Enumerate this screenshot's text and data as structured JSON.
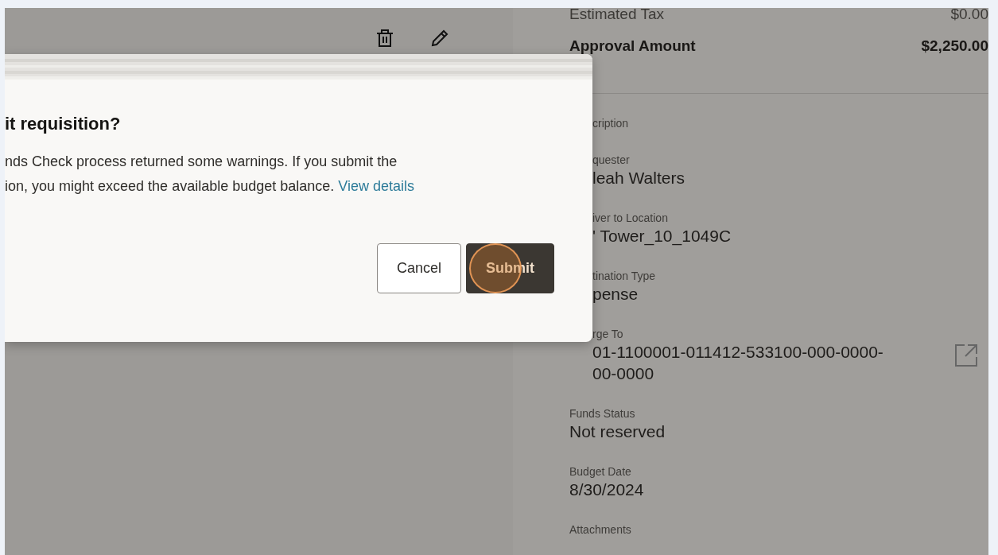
{
  "toolbar": {
    "icons": [
      {
        "kind": "delete"
      },
      {
        "kind": "edit"
      }
    ]
  },
  "dialog": {
    "title": "it requisition?",
    "message_lines": [
      "nds Check process returned some warnings. If you submit the",
      "ion, you might exceed the available budget balance."
    ],
    "link": "View details",
    "buttons": [
      {
        "label": "Cancel",
        "primary": false,
        "focused": false
      },
      {
        "label": "Submit",
        "primary": true,
        "focused": true
      }
    ]
  },
  "summary": [
    {
      "label": "Estimated Tax",
      "value": "$0.00",
      "emphasis": false
    },
    {
      "label": "Approval Amount",
      "value": "$2,250.00",
      "emphasis": true
    }
  ],
  "fields": [
    {
      "kind": "clipped",
      "label": "cription"
    },
    {
      "kind": "clipped",
      "label": "quester",
      "value": "leah Walters"
    },
    {
      "kind": "clipped",
      "label": "iver to Location",
      "value": "' Tower_10_1049C"
    },
    {
      "kind": "clipped",
      "label": "tination Type",
      "value": "pense"
    },
    {
      "kind": "clipped",
      "label": "rge To",
      "value": "01-1100001-011412-533100-000-0000-00-0000",
      "link_icon": true
    },
    {
      "kind": "full",
      "label": "Funds Status",
      "value": "Not reserved"
    },
    {
      "kind": "full",
      "label": "Budget Date",
      "value": "8/30/2024"
    },
    {
      "kind": "full",
      "label": "Attachments"
    }
  ]
}
